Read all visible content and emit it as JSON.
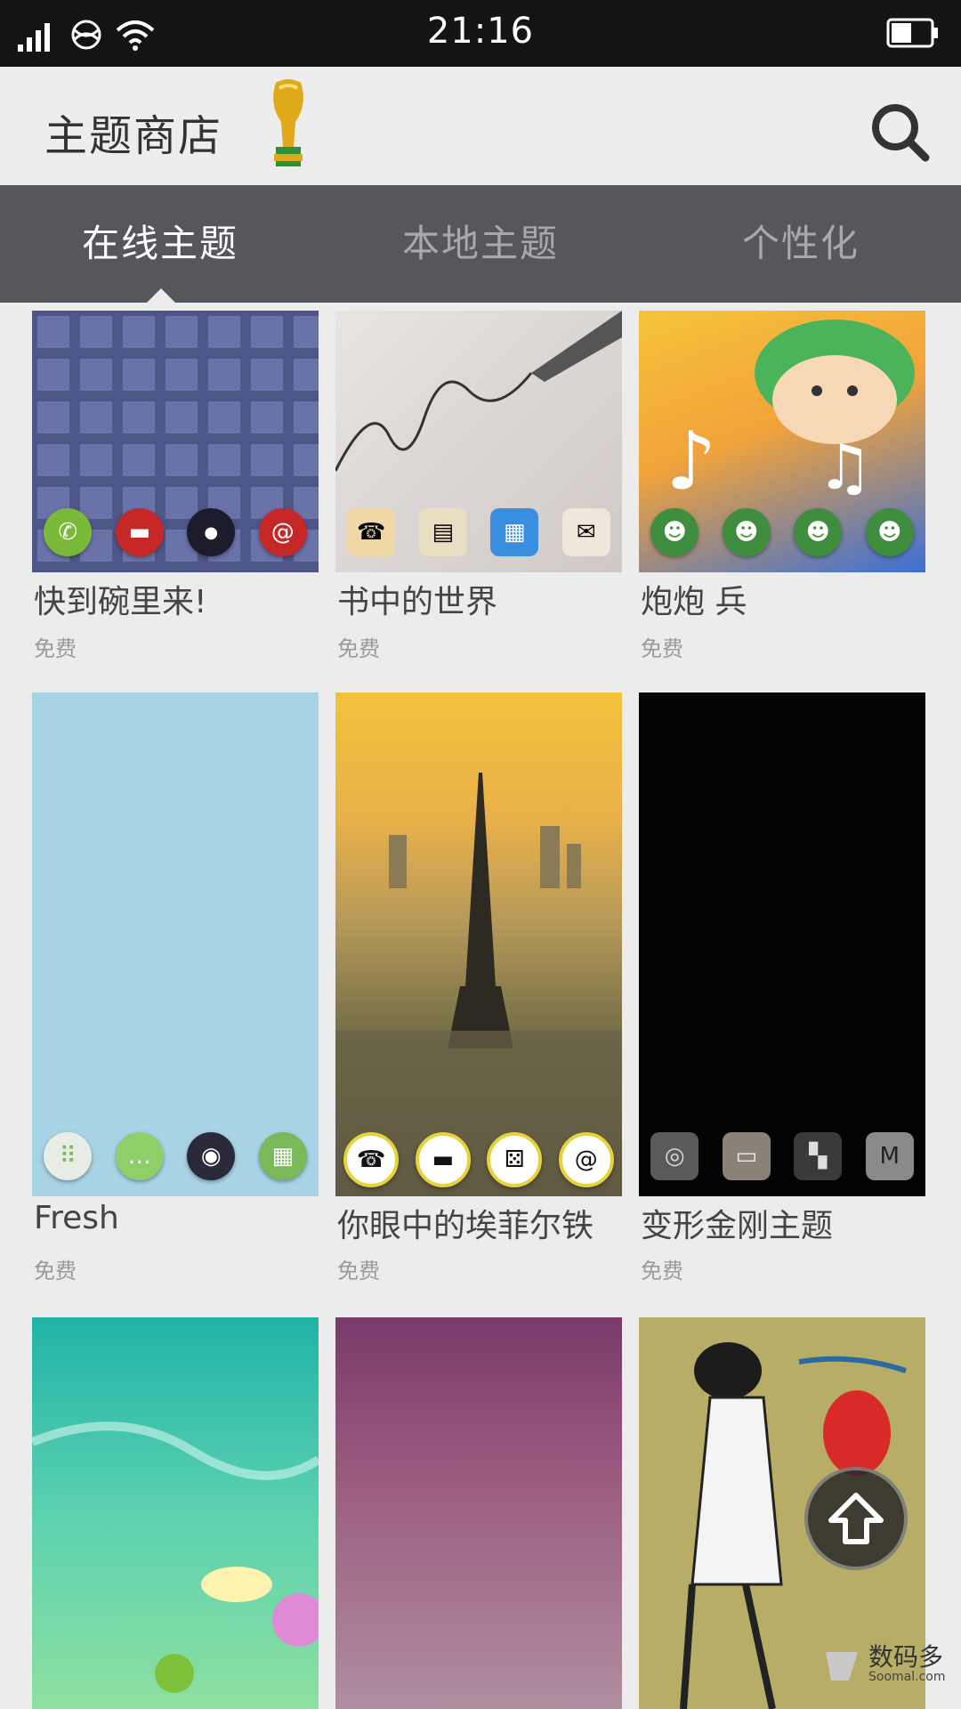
{
  "status_bar": {
    "time": "21:16"
  },
  "header": {
    "title": "主题商店"
  },
  "tabs": [
    {
      "label": "在线主题",
      "active": true
    },
    {
      "label": "本地主题",
      "active": false
    },
    {
      "label": "个性化",
      "active": false
    }
  ],
  "themes": [
    {
      "title": "快到碗里来!",
      "price": "免费"
    },
    {
      "title": "书中的世界",
      "price": "免费"
    },
    {
      "title": "炮炮 兵",
      "price": "免费"
    },
    {
      "title": "Fresh",
      "price": "免费"
    },
    {
      "title": "你眼中的埃菲尔铁",
      "price": "免费"
    },
    {
      "title": "变形金刚主题",
      "price": "免费"
    }
  ],
  "watermark": {
    "main": "数码多",
    "sub": "Soomal.com"
  }
}
